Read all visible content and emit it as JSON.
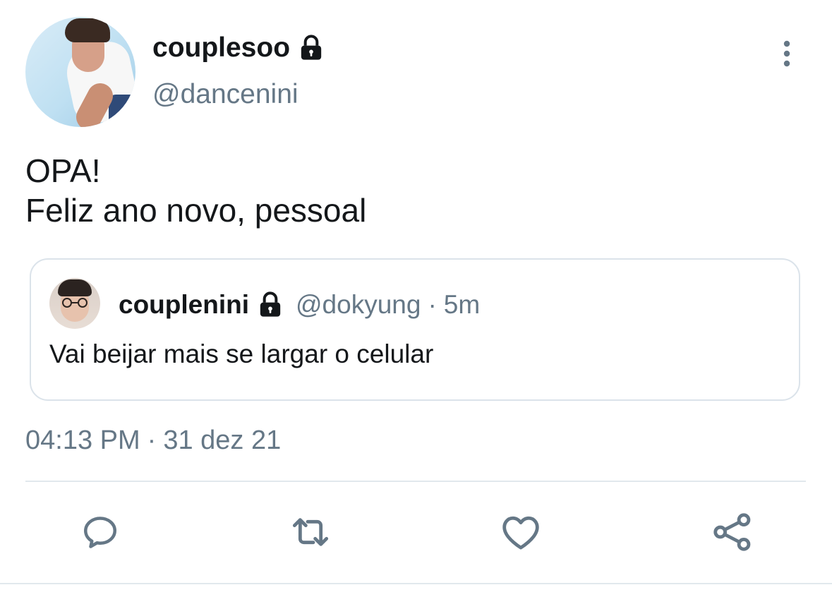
{
  "author": {
    "display_name": "couplesoo",
    "handle": "@dancenini",
    "protected": true
  },
  "tweet": {
    "lines": [
      "OPA!",
      "Feliz ano novo, pessoal"
    ],
    "timestamp_time": "04:13 PM",
    "timestamp_separator": "·",
    "timestamp_date": "31 dez 21"
  },
  "quoted_tweet": {
    "display_name": "couplenini",
    "handle": "@dokyung",
    "separator": "·",
    "time": "5m",
    "text": "Vai beijar mais se largar o celular",
    "protected": true
  },
  "actions": [
    {
      "name": "reply",
      "icon": "reply-icon"
    },
    {
      "name": "retweet",
      "icon": "retweet-icon"
    },
    {
      "name": "like",
      "icon": "heart-icon"
    },
    {
      "name": "share",
      "icon": "share-icon"
    }
  ],
  "colors": {
    "text": "#14171a",
    "secondary": "#657786",
    "border": "#dbe3ea",
    "divider": "#e1e8ed"
  }
}
